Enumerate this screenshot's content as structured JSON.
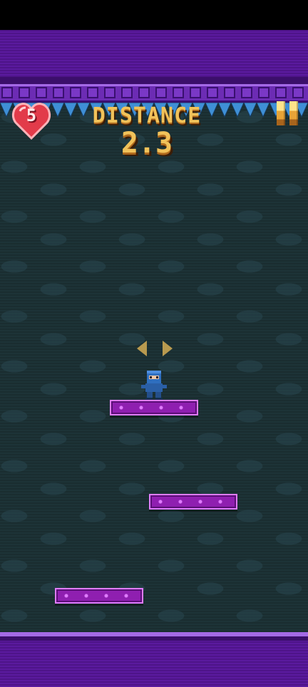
{
  "hud": {
    "lives": "5",
    "distance_label": "DISTANCE",
    "distance_value": "2.3"
  },
  "icons": {
    "lives": "heart-icon",
    "pause": "pause-icon",
    "hint": "left-right-arrows-icon",
    "player": "ninja-character"
  },
  "colors": {
    "background": "#1d3337",
    "border_purple": "#5a1a9e",
    "platform": "#8f1fb0",
    "platform_edge": "#e07cff",
    "hud_gold": "#f1c25a",
    "heart_red": "#e23b4a",
    "spikes_blue": "#3f8fd6"
  },
  "scene": {
    "platforms": [
      {
        "name": "platform-upper"
      },
      {
        "name": "platform-middle"
      },
      {
        "name": "platform-lower"
      }
    ]
  }
}
